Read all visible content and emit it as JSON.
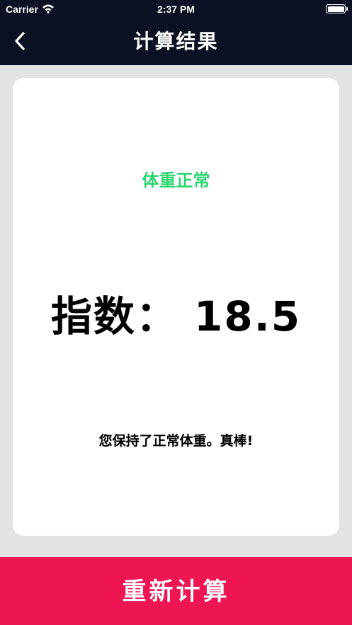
{
  "status_bar": {
    "carrier": "Carrier",
    "time": "2:37 PM",
    "icons": [
      "wifi-icon",
      "battery-icon"
    ]
  },
  "nav": {
    "back_icon": "chevron-left-icon",
    "title": "计算结果"
  },
  "result": {
    "status_label": "体重正常",
    "status_color": "#2ed573",
    "index_text": "指数：  18.5",
    "index_value": 18.5,
    "message": "您保持了正常体重。真棒!"
  },
  "footer": {
    "recalc_label": "重新计算",
    "button_color": "#ee1652"
  },
  "colors": {
    "header_background": "#0b1022",
    "page_background": "#e3e3e3"
  }
}
